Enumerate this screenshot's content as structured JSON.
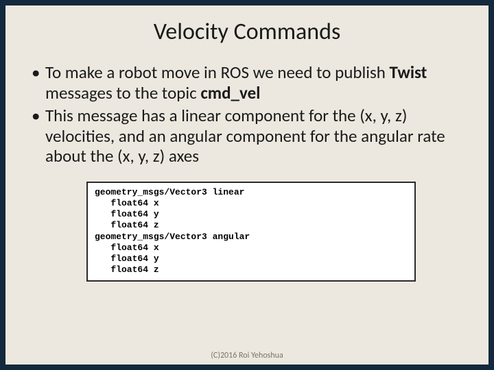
{
  "title": "Velocity Commands",
  "bullets": [
    {
      "pre": "To make a robot move in ROS we need to publish ",
      "bold1": "Twist",
      "mid": " messages to the topic ",
      "bold2": "cmd_vel",
      "post": ""
    },
    {
      "pre": "This message has a linear component for the (x, y, z) velocities, and an angular component for the angular rate about the (x, y, z) axes",
      "bold1": "",
      "mid": "",
      "bold2": "",
      "post": ""
    }
  ],
  "code": "geometry_msgs/Vector3 linear\n   float64 x\n   float64 y\n   float64 z\ngeometry_msgs/Vector3 angular\n   float64 x\n   float64 y\n   float64 z",
  "footer": "(C)2016 Roi Yehoshua"
}
